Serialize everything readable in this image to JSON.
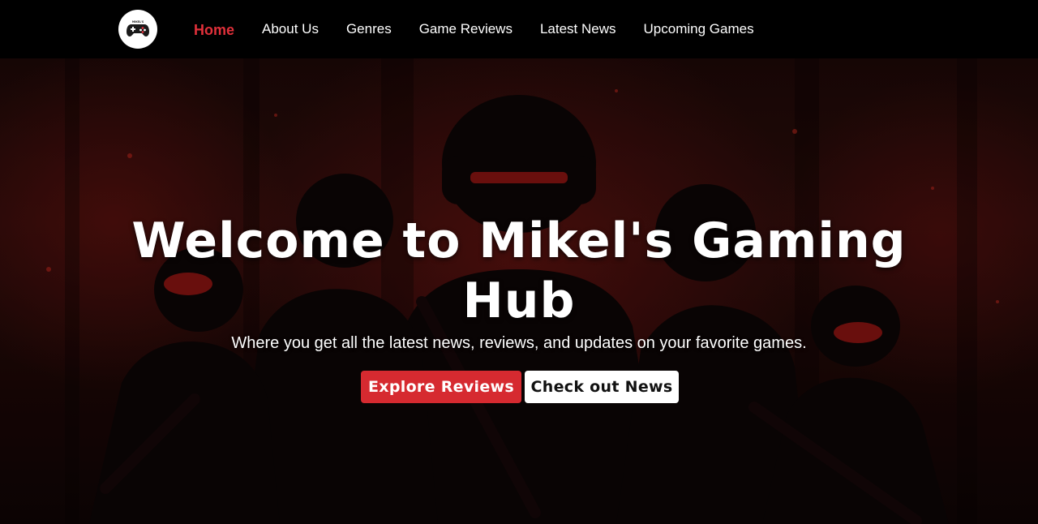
{
  "nav": {
    "logo_label": "MIKEL'S",
    "items": [
      {
        "label": "Home",
        "active": true
      },
      {
        "label": "About Us",
        "active": false
      },
      {
        "label": "Genres",
        "active": false
      },
      {
        "label": "Game Reviews",
        "active": false
      },
      {
        "label": "Latest News",
        "active": false
      },
      {
        "label": "Upcoming Games",
        "active": false
      }
    ]
  },
  "hero": {
    "title": "Welcome to Mikel's Gaming Hub",
    "subtitle": "Where you get all the latest news, reviews, and updates on your favorite games.",
    "primary_button": "Explore Reviews",
    "secondary_button": "Check out News"
  },
  "colors": {
    "accent": "#d62a30",
    "active_nav": "#e0303a",
    "navbar_bg": "#000000"
  },
  "icons": {
    "logo": "gamepad-icon"
  }
}
